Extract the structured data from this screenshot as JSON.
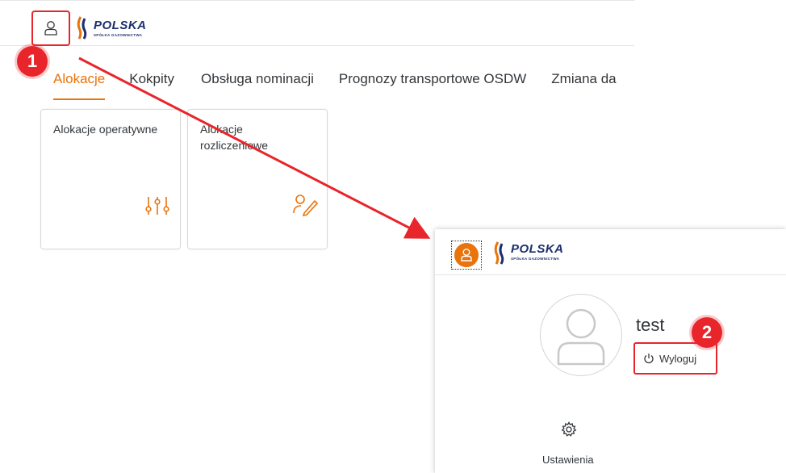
{
  "logo": {
    "brand": "POLSKA",
    "subtitle": "SPÓŁKA GAZOWNICTWA"
  },
  "tabs": [
    {
      "label": "Alokacje",
      "active": true
    },
    {
      "label": "Kokpity",
      "active": false
    },
    {
      "label": "Obsługa nominacji",
      "active": false
    },
    {
      "label": "Prognozy transportowe OSDW",
      "active": false
    },
    {
      "label": "Zmiana da",
      "active": false
    }
  ],
  "tiles": [
    {
      "title": "Alokacje operatywne",
      "icon": "sliders-icon"
    },
    {
      "title": "Alokacje rozliczeniowe",
      "icon": "edit-user-icon"
    }
  ],
  "callouts": {
    "step1": "1",
    "step2": "2"
  },
  "popup": {
    "user_name": "test",
    "logout_label": "Wyloguj",
    "settings_label": "Ustawienia"
  },
  "colors": {
    "accent": "#e9730c",
    "highlight": "#e8252b",
    "brand": "#1d2f6e"
  }
}
